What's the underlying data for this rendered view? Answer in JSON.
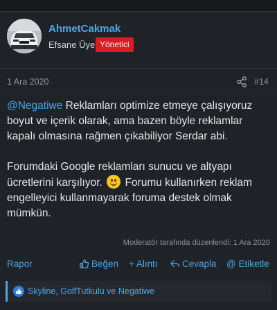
{
  "post": {
    "username": "AhmetCakmak",
    "user_title": "Efsane Üye",
    "role_badge": "Yönetici",
    "date": "1 Ara 2020",
    "post_number": "#14",
    "mention": "@Negatiwe",
    "paragraph1": " Reklamları optimize etmeye çalışıyoruz boyut ve içerik olarak, ama bazen böyle reklamlar kapalı olmasına rağmen çıkabiliyor Serdar abi.",
    "paragraph2_before": "Forumdaki Google reklamları sunucu ve altyapı ücretlerini karşılıyor. ",
    "paragraph2_after": " Forumu kullanırken reklam engelleyici kullanmayarak foruma destek olmak mümkün.",
    "edited_note": "Moderatör tarafında düzenlendi: 1 Ara 2020"
  },
  "actions": {
    "report": "Rapor",
    "like": "Beğen",
    "quote": "+ Alıntı",
    "reply": "Cevapla",
    "tag": "@ Etiketle"
  },
  "reactions": {
    "text": "Skyline, GolfTutkulu ve Negatiwe"
  },
  "colors": {
    "accent": "#4aa7e8",
    "badge": "#e01922",
    "background": "#1f2226"
  },
  "icons": [
    "share-icon",
    "thumbs-up-icon",
    "reply-arrow-icon",
    "like-reaction-icon",
    "smiley-emoji"
  ]
}
